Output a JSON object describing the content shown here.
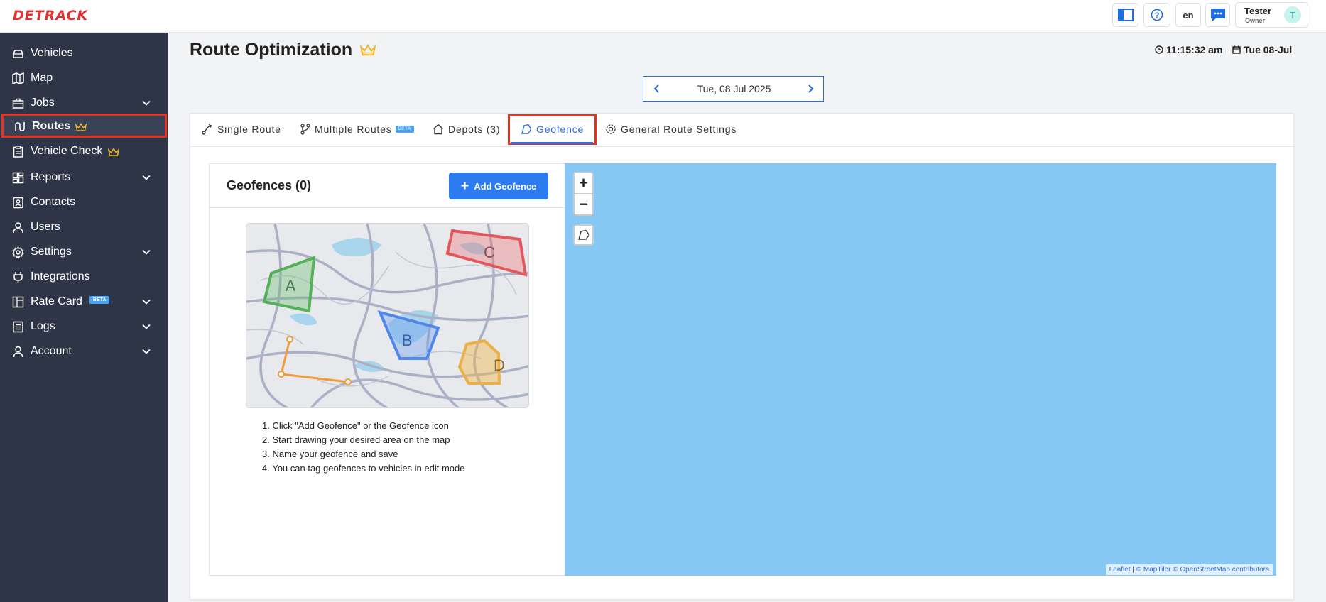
{
  "app": {
    "logo_text": "DETRACK",
    "language": "en",
    "user": {
      "name": "Tester",
      "role": "Owner",
      "initial": "T"
    }
  },
  "sidebar": {
    "items": [
      {
        "label": "Vehicles",
        "icon": "car-icon"
      },
      {
        "label": "Map",
        "icon": "map-icon"
      },
      {
        "label": "Jobs",
        "icon": "briefcase-icon",
        "expandable": true
      },
      {
        "label": "Routes",
        "icon": "route-icon",
        "active": true,
        "premium": true
      },
      {
        "label": "Vehicle Check",
        "icon": "clipboard-icon",
        "premium": true
      },
      {
        "label": "Reports",
        "icon": "dashboard-icon",
        "expandable": true
      },
      {
        "label": "Contacts",
        "icon": "contact-book-icon"
      },
      {
        "label": "Users",
        "icon": "user-icon"
      },
      {
        "label": "Settings",
        "icon": "gear-icon",
        "expandable": true
      },
      {
        "label": "Integrations",
        "icon": "plug-icon"
      },
      {
        "label": "Rate Card",
        "icon": "rate-card-icon",
        "badge": "BETA",
        "expandable": true
      },
      {
        "label": "Logs",
        "icon": "list-icon",
        "expandable": true
      },
      {
        "label": "Account",
        "icon": "account-icon",
        "expandable": true
      }
    ]
  },
  "header": {
    "title": "Route Optimization",
    "time": "11:15:32 am",
    "date": "Tue 08-Jul"
  },
  "date_nav": {
    "label": "Tue, 08 Jul 2025"
  },
  "tabs": [
    {
      "label": "Single Route"
    },
    {
      "label": "Multiple Routes",
      "badge": "BETA"
    },
    {
      "label": "Depots (3)"
    },
    {
      "label": "Geofence",
      "active": true
    },
    {
      "label": "General Route Settings"
    }
  ],
  "geofences": {
    "title": "Geofences (0)",
    "add_button": "Add Geofence",
    "illustration_labels": [
      "A",
      "B",
      "C",
      "D"
    ],
    "steps": [
      "1. Click \"Add Geofence\" or the Geofence icon",
      "2. Start drawing your desired area on the map",
      "3. Name your geofence and save",
      "4. You can tag geofences to vehicles in edit mode"
    ]
  },
  "map": {
    "zoom_in": "+",
    "zoom_out": "−",
    "attribution": {
      "leaflet": "Leaflet",
      "sep": " | ",
      "maptiler": "© MapTiler",
      "osm": "© OpenStreetMap contributors"
    }
  },
  "colors": {
    "sidebar_bg": "#2e3547",
    "accent_blue": "#2d7bf0",
    "highlight_red": "#e8321e",
    "map_water": "#86c8f3",
    "crown_gold": "#f0b429"
  }
}
